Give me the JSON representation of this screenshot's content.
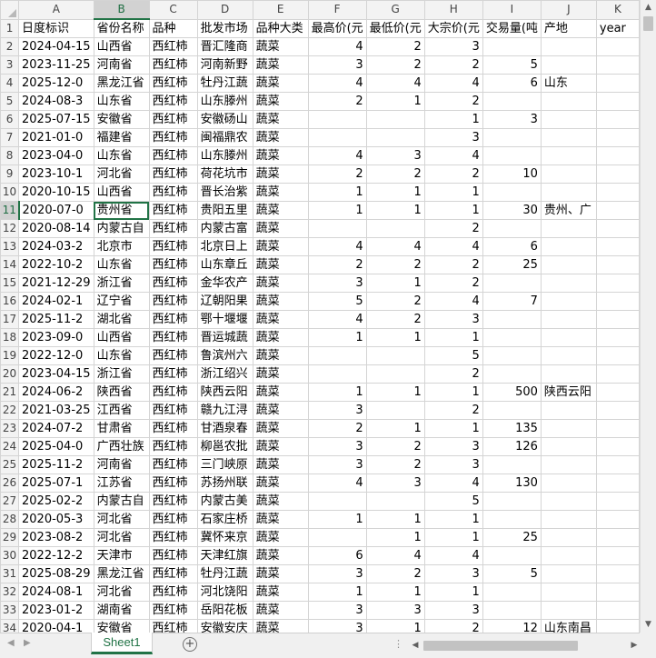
{
  "sheet": {
    "active_cell": "B11",
    "columns": [
      "A",
      "B",
      "C",
      "D",
      "E",
      "F",
      "G",
      "H",
      "I",
      "J",
      "K"
    ],
    "rows": [
      [
        "日度标识",
        "省份名称",
        "品种",
        "批发市场",
        "品种大类",
        "最高价(元",
        "最低价(元",
        "大宗价(元",
        "交易量(吨",
        "产地",
        "year"
      ],
      [
        "2024-04-15",
        "山西省",
        "西红柿",
        "晋汇隆商",
        "蔬菜",
        "4",
        "2",
        "3",
        "",
        "",
        ""
      ],
      [
        "2023-11-25",
        "河南省",
        "西红柿",
        "河南新野",
        "蔬菜",
        "3",
        "2",
        "2",
        "5",
        "",
        ""
      ],
      [
        "2025-12-0",
        "黑龙江省",
        "西红柿",
        "牡丹江蔬",
        "蔬菜",
        "4",
        "4",
        "4",
        "6",
        "山东",
        ""
      ],
      [
        "2024-08-3",
        "山东省",
        "西红柿",
        "山东滕州",
        "蔬菜",
        "2",
        "1",
        "2",
        "",
        "",
        ""
      ],
      [
        "2025-07-15",
        "安徽省",
        "西红柿",
        "安徽砀山",
        "蔬菜",
        "",
        "",
        "1",
        "3",
        "",
        ""
      ],
      [
        "2021-01-0",
        "福建省",
        "西红柿",
        "闽福鼎农",
        "蔬菜",
        "",
        "",
        "3",
        "",
        "",
        ""
      ],
      [
        "2023-04-0",
        "山东省",
        "西红柿",
        "山东滕州",
        "蔬菜",
        "4",
        "3",
        "4",
        "",
        "",
        ""
      ],
      [
        "2023-10-1",
        "河北省",
        "西红柿",
        "荷花坑市",
        "蔬菜",
        "2",
        "2",
        "2",
        "10",
        "",
        ""
      ],
      [
        "2020-10-15",
        "山西省",
        "西红柿",
        "晋长治紫",
        "蔬菜",
        "1",
        "1",
        "1",
        "",
        "",
        ""
      ],
      [
        "2020-07-0",
        "贵州省",
        "西红柿",
        "贵阳五里",
        "蔬菜",
        "1",
        "1",
        "1",
        "30",
        "贵州、广",
        ""
      ],
      [
        "2020-08-14",
        "内蒙古自",
        "西红柿",
        "内蒙古富",
        "蔬菜",
        "",
        "",
        "2",
        "",
        "",
        ""
      ],
      [
        "2024-03-2",
        "北京市",
        "西红柿",
        "北京日上",
        "蔬菜",
        "4",
        "4",
        "4",
        "6",
        "",
        ""
      ],
      [
        "2022-10-2",
        "山东省",
        "西红柿",
        "山东章丘",
        "蔬菜",
        "2",
        "2",
        "2",
        "25",
        "",
        ""
      ],
      [
        "2021-12-29",
        "浙江省",
        "西红柿",
        "金华农产",
        "蔬菜",
        "3",
        "1",
        "2",
        "",
        "",
        ""
      ],
      [
        "2024-02-1",
        "辽宁省",
        "西红柿",
        "辽朝阳果",
        "蔬菜",
        "5",
        "2",
        "4",
        "7",
        "",
        ""
      ],
      [
        "2025-11-2",
        "湖北省",
        "西红柿",
        "鄂十堰堰",
        "蔬菜",
        "4",
        "2",
        "3",
        "",
        "",
        ""
      ],
      [
        "2023-09-0",
        "山西省",
        "西红柿",
        "晋运城蔬",
        "蔬菜",
        "1",
        "1",
        "1",
        "",
        "",
        ""
      ],
      [
        "2022-12-0",
        "山东省",
        "西红柿",
        "鲁滨州六",
        "蔬菜",
        "",
        "",
        "5",
        "",
        "",
        ""
      ],
      [
        "2023-04-15",
        "浙江省",
        "西红柿",
        "浙江绍兴",
        "蔬菜",
        "",
        "",
        "2",
        "",
        "",
        ""
      ],
      [
        "2024-06-2",
        "陕西省",
        "西红柿",
        "陕西云阳",
        "蔬菜",
        "1",
        "1",
        "1",
        "500",
        "陕西云阳",
        ""
      ],
      [
        "2021-03-25",
        "江西省",
        "西红柿",
        "赣九江浔",
        "蔬菜",
        "3",
        "",
        "2",
        "",
        "",
        ""
      ],
      [
        "2024-07-2",
        "甘肃省",
        "西红柿",
        "甘酒泉春",
        "蔬菜",
        "2",
        "1",
        "1",
        "135",
        "",
        ""
      ],
      [
        "2025-04-0",
        "广西壮族",
        "西红柿",
        "柳邕农批",
        "蔬菜",
        "3",
        "2",
        "3",
        "126",
        "",
        ""
      ],
      [
        "2025-11-2",
        "河南省",
        "西红柿",
        "三门峡原",
        "蔬菜",
        "3",
        "2",
        "3",
        "",
        "",
        ""
      ],
      [
        "2025-07-1",
        "江苏省",
        "西红柿",
        "苏扬州联",
        "蔬菜",
        "4",
        "3",
        "4",
        "130",
        "",
        ""
      ],
      [
        "2025-02-2",
        "内蒙古自",
        "西红柿",
        "内蒙古美",
        "蔬菜",
        "",
        "",
        "5",
        "",
        "",
        ""
      ],
      [
        "2020-05-3",
        "河北省",
        "西红柿",
        "石家庄桥",
        "蔬菜",
        "1",
        "1",
        "1",
        "",
        "",
        ""
      ],
      [
        "2023-08-2",
        "河北省",
        "西红柿",
        "冀怀来京",
        "蔬菜",
        "",
        "1",
        "1",
        "25",
        "",
        ""
      ],
      [
        "2022-12-2",
        "天津市",
        "西红柿",
        "天津红旗",
        "蔬菜",
        "6",
        "4",
        "4",
        "",
        "",
        ""
      ],
      [
        "2025-08-29",
        "黑龙江省",
        "西红柿",
        "牡丹江蔬",
        "蔬菜",
        "3",
        "2",
        "3",
        "5",
        "",
        ""
      ],
      [
        "2024-08-1",
        "河北省",
        "西红柿",
        "河北饶阳",
        "蔬菜",
        "1",
        "1",
        "1",
        "",
        "",
        ""
      ],
      [
        "2023-01-2",
        "湖南省",
        "西红柿",
        "岳阳花板",
        "蔬菜",
        "3",
        "3",
        "3",
        "",
        "",
        ""
      ],
      [
        "2020-04-1",
        "安徽省",
        "西红柿",
        "安徽安庆",
        "蔬菜",
        "3",
        "1",
        "2",
        "12",
        "山东南昌",
        ""
      ]
    ]
  },
  "sheet_tab": {
    "label": "Sheet1"
  },
  "icons": {
    "add_sheet": "plus-circle-icon",
    "scroll_up": "triangle-up-icon",
    "scroll_down": "triangle-down-icon",
    "scroll_left": "triangle-left-icon",
    "scroll_right": "triangle-right-icon"
  },
  "colors": {
    "accent": "#217346",
    "header_bg": "#f3f3f3",
    "grid": "#d4d4d4"
  }
}
